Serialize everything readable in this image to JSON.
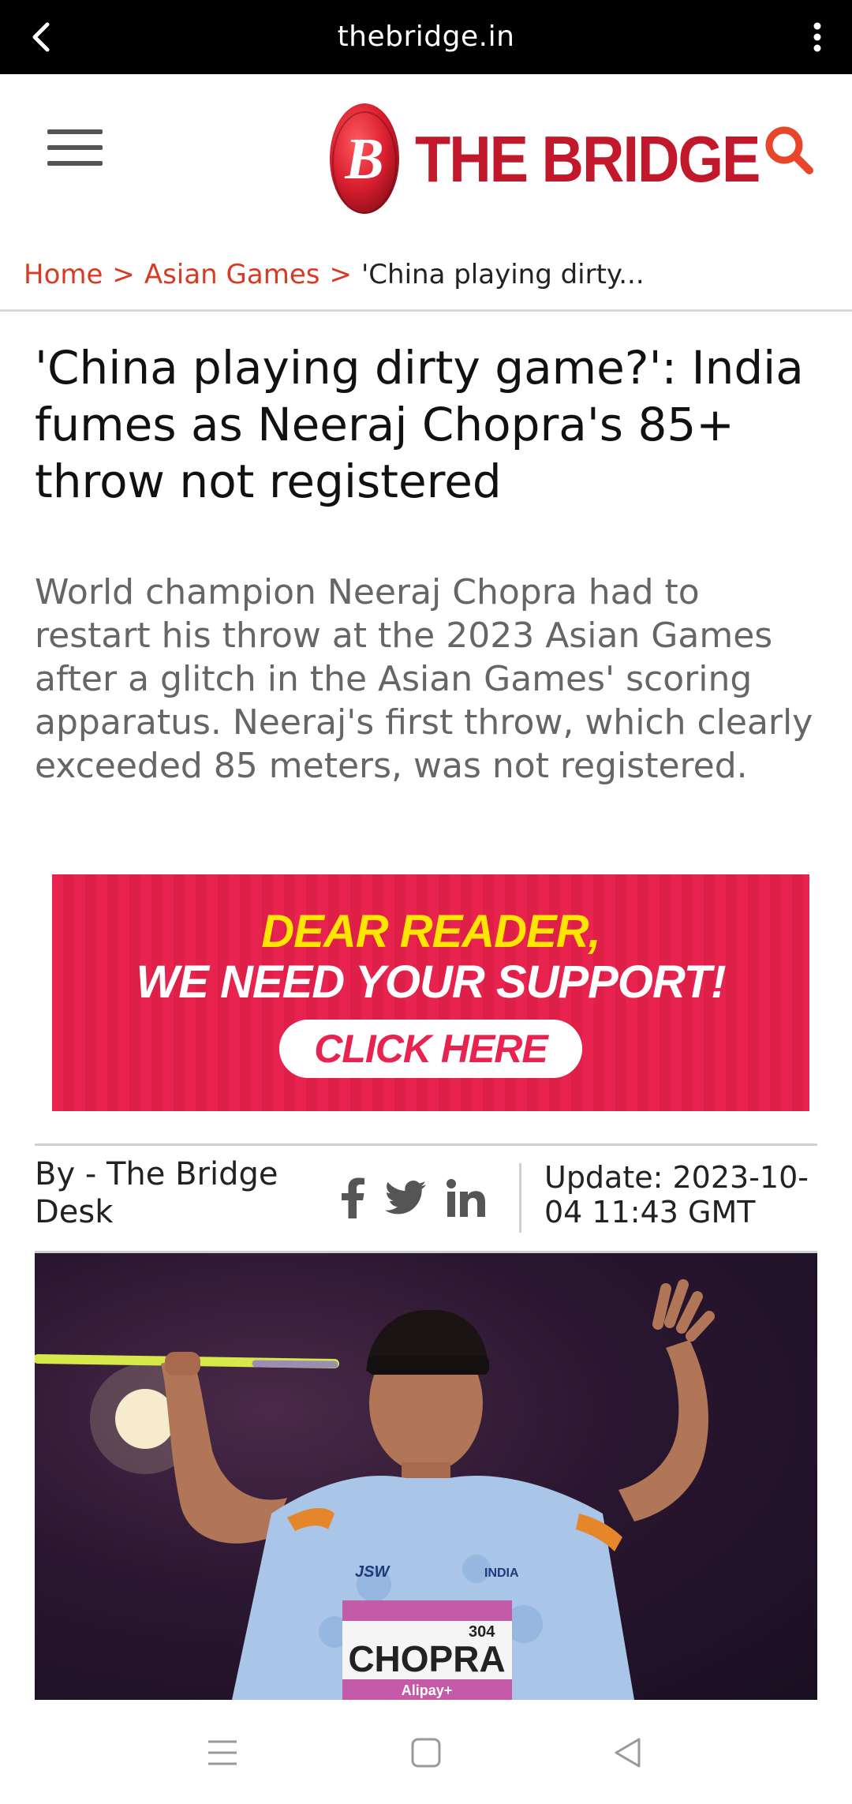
{
  "browser": {
    "url": "thebridge.in"
  },
  "header": {
    "logo_text": "THE BRIDGE",
    "logo_letter": "B"
  },
  "breadcrumb": {
    "items": [
      "Home",
      "Asian Games"
    ],
    "separator": ">",
    "current": "'China playing dirty..."
  },
  "article": {
    "headline": "'China playing dirty game?': India fumes as Neeraj Chopra's 85+ throw not registered",
    "summary": "World champion Neeraj Chopra had to restart his throw at the 2023 Asian Games after a glitch in the Asian Games' scoring apparatus. Neeraj's first throw, which clearly exceeded 85 meters, was not registered.",
    "author": "By - The Bridge Desk",
    "update": "Update: 2023-10-04 11:43 GMT",
    "image": {
      "bib_name": "CHOPRA",
      "bib_number": "304",
      "bib_sponsor": "Alipay+",
      "jersey_brand": "JSW",
      "jersey_country": "INDIA"
    }
  },
  "banner": {
    "line1": "DEAR READER,",
    "line2": "WE NEED YOUR SUPPORT!",
    "cta": "CLICK HERE"
  },
  "social": {
    "icons": [
      "facebook-icon",
      "twitter-icon",
      "linkedin-icon"
    ]
  },
  "colors": {
    "brand_red": "#c2182b",
    "link_orange": "#d93a22",
    "banner_red": "#e8234f",
    "banner_yellow": "#ffe600"
  }
}
